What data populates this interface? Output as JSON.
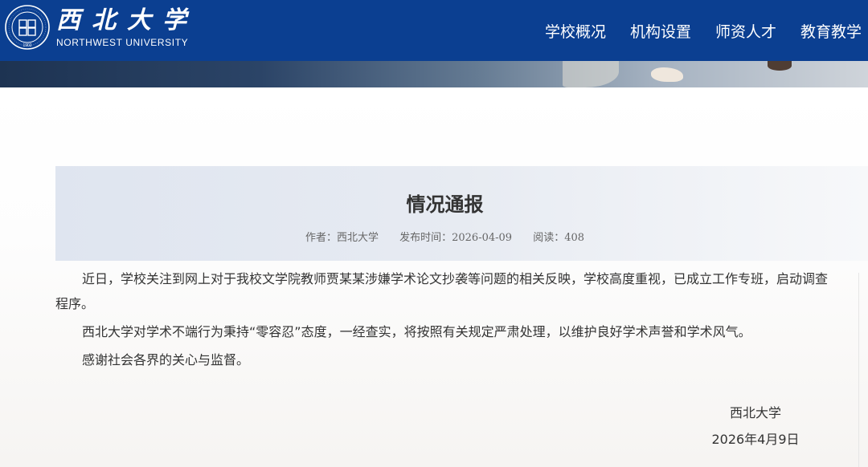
{
  "header": {
    "brand_cn": "西北大学",
    "brand_en": "NORTHWEST UNIVERSITY",
    "seal_year": "1902",
    "nav": [
      "学校概况",
      "机构设置",
      "师资人才",
      "教育教学"
    ]
  },
  "article": {
    "title": "情况通报",
    "author_label": "作者：西北大学",
    "publish_label": "发布时间：2026-04-09",
    "reads_label": "阅读：408",
    "paragraphs": [
      "近日，学校关注到网上对于我校文学院教师贾某某涉嫌学术论文抄袭等问题的相关反映，学校高度重视，已成立工作专班，启动调查程序。",
      "西北大学对学术不端行为秉持“零容忍”态度，一经查实，将按照有关规定严肃处理，以维护良好学术声誉和学术风气。",
      "感谢社会各界的关心与监督。"
    ],
    "signature_org": "西北大学",
    "signature_date": "2026年4月9日"
  },
  "colors": {
    "header_blue": "#0b3f91",
    "title_box": "#e3e8f1"
  }
}
